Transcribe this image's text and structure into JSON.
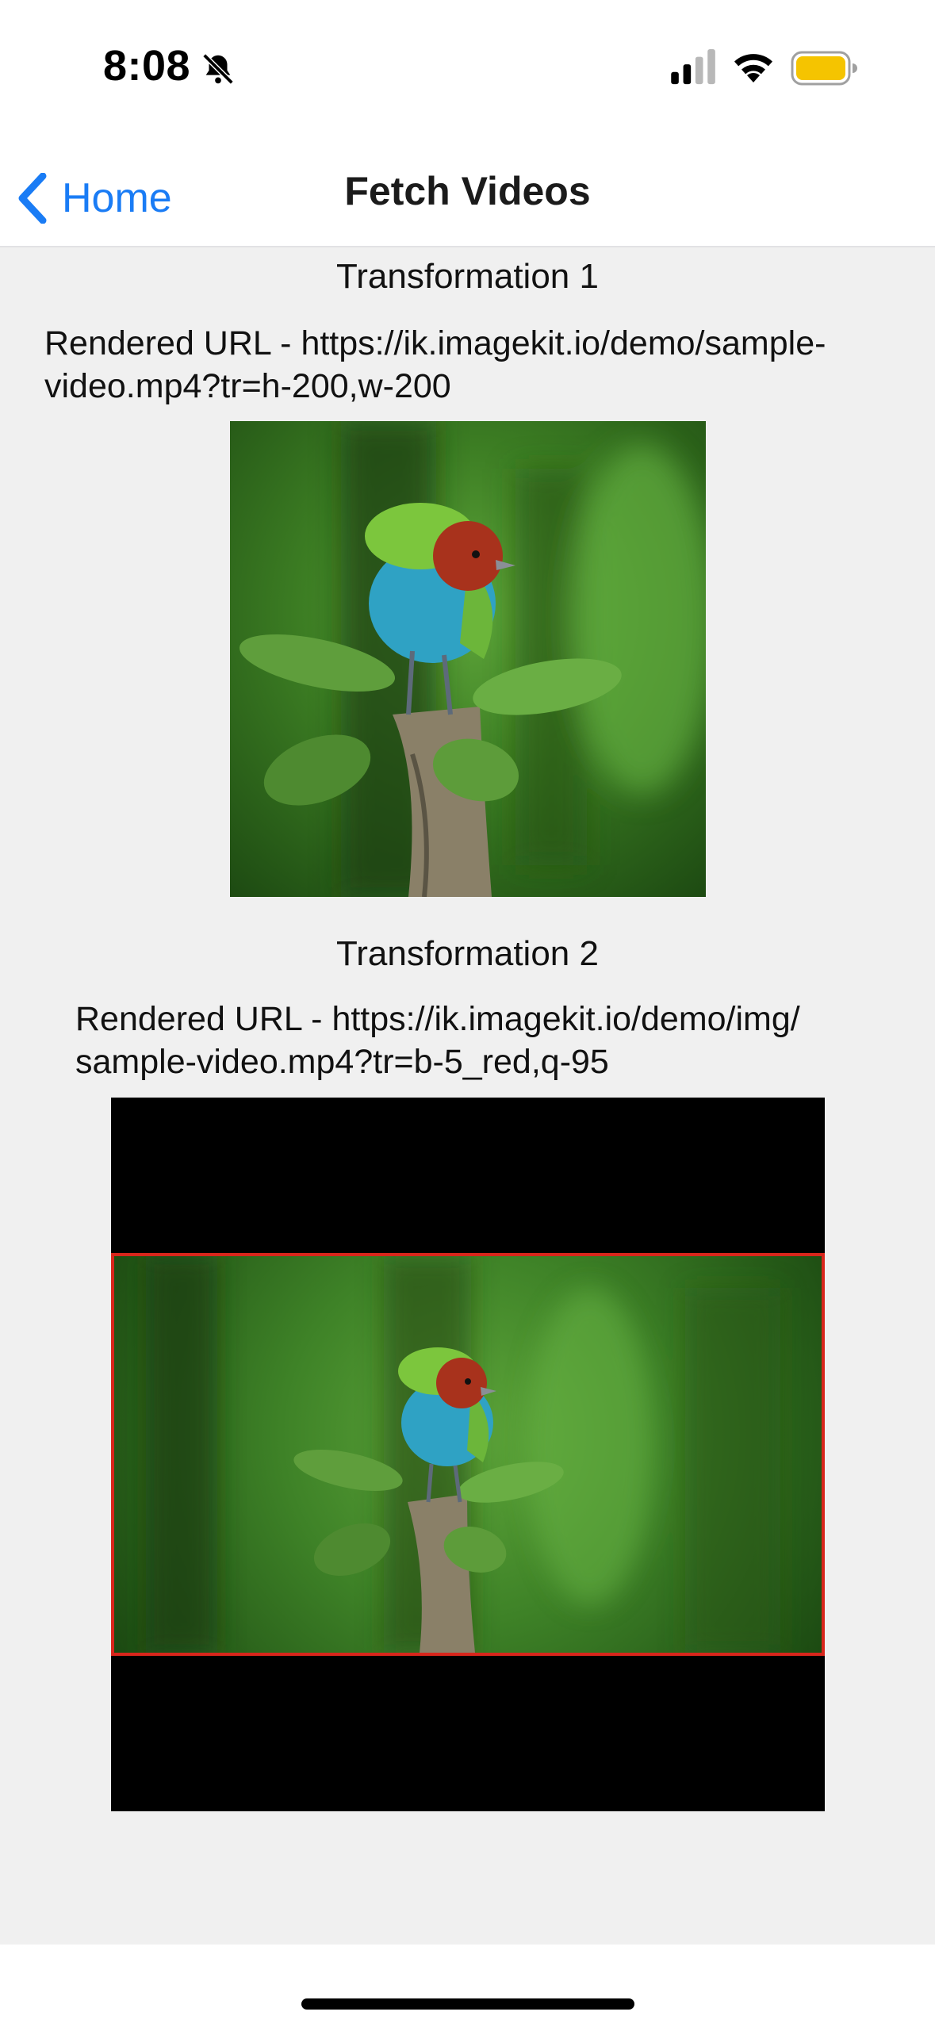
{
  "status_bar": {
    "time": "8:08",
    "battery_color": "#f5c400"
  },
  "nav": {
    "back_label": "Home",
    "title": "Fetch Videos",
    "accent_color": "#1a7cf5"
  },
  "transformations": [
    {
      "title": "Transformation 1",
      "url_line1": "Rendered URL - https://ik.imagekit.io/demo/sample-",
      "url_line2": "video.mp4?tr=h-200,w-200"
    },
    {
      "title": "Transformation 2",
      "url_line1": "Rendered URL - https://ik.imagekit.io/demo/img/",
      "url_line2": "sample-video.mp4?tr=b-5_red,q-95",
      "border_color": "#d8261c"
    }
  ]
}
